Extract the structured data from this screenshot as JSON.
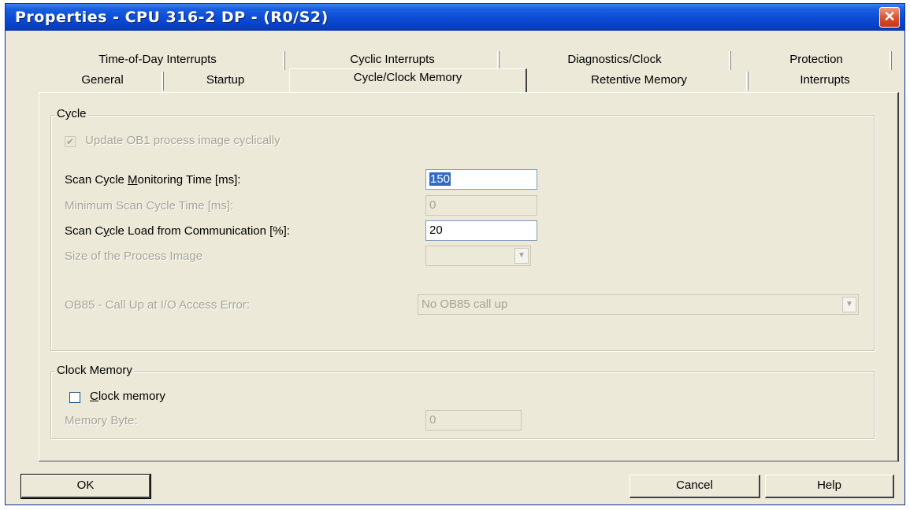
{
  "window": {
    "title": "Properties - CPU 316-2 DP - (R0/S2)",
    "close_glyph": "✕"
  },
  "tabs": {
    "row1": [
      "Time-of-Day Interrupts",
      "Cyclic Interrupts",
      "Diagnostics/Clock",
      "Protection"
    ],
    "row2": [
      "General",
      "Startup",
      "Cycle/Clock Memory",
      "Retentive Memory",
      "Interrupts"
    ],
    "active": "Cycle/Clock Memory"
  },
  "cycle": {
    "group_title": "Cycle",
    "update_ob1_label": "Update OB1 process image cyclically",
    "update_ob1_checked": true,
    "scan_monitoring_label_pre": "Scan Cycle ",
    "scan_monitoring_label_u": "M",
    "scan_monitoring_label_post": "onitoring Time [ms]:",
    "scan_monitoring_value": "150",
    "min_scan_label": "Minimum Scan Cycle Time [ms]:",
    "min_scan_value": "0",
    "load_comm_label_pre": "Scan C",
    "load_comm_label_u": "y",
    "load_comm_label_post": "cle Load from Communication [%]:",
    "load_comm_value": "20",
    "process_image_label": "Size of the Process Image",
    "process_image_value": "",
    "ob85_label": "OB85 - Call Up at I/O Access Error:",
    "ob85_value": "No OB85 call up"
  },
  "clock_memory": {
    "group_title": "Clock Memory",
    "clock_memory_label_u": "C",
    "clock_memory_label_post": "lock memory",
    "clock_memory_checked": false,
    "memory_byte_label": "Memory Byte:",
    "memory_byte_value": "0"
  },
  "buttons": {
    "ok": "OK",
    "cancel": "Cancel",
    "help": "Help"
  },
  "icons": {
    "dropdown": "▼",
    "check": "✔"
  }
}
